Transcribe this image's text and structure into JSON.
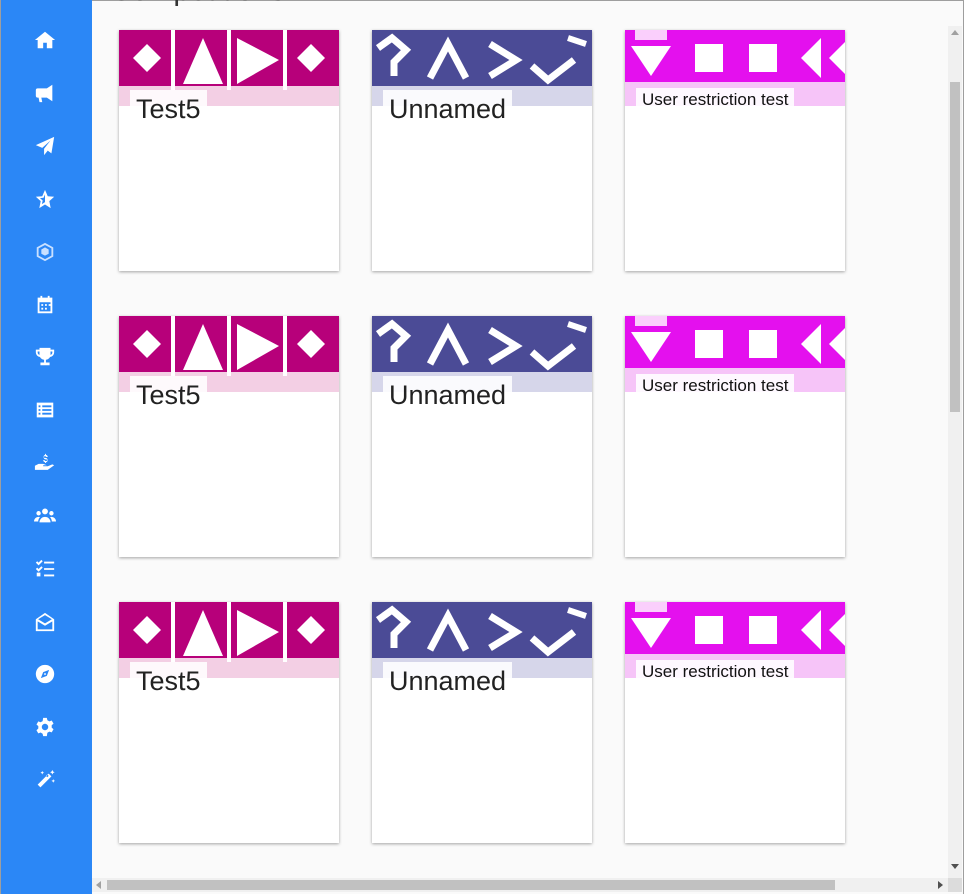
{
  "page": {
    "heading": "Competitions"
  },
  "sidebar": {
    "items": [
      {
        "icon": "home-icon"
      },
      {
        "icon": "megaphone-icon"
      },
      {
        "icon": "paper-plane-icon"
      },
      {
        "icon": "star-icon"
      },
      {
        "icon": "network-icon"
      },
      {
        "icon": "calendar-icon"
      },
      {
        "icon": "trophy-icon"
      },
      {
        "icon": "list-icon"
      },
      {
        "icon": "hand-dollar-icon"
      },
      {
        "icon": "users-icon"
      },
      {
        "icon": "tasks-icon"
      },
      {
        "icon": "envelope-open-icon"
      },
      {
        "icon": "compass-icon"
      },
      {
        "icon": "gear-icon"
      },
      {
        "icon": "magic-wand-icon"
      }
    ]
  },
  "colors": {
    "sidebar": "#2b87f6",
    "banner_test5": "#b7007a",
    "banner_unnamed": "#4b4b96",
    "banner_user": "#e410ee"
  },
  "cards": [
    {
      "title": "Test5",
      "style": "big",
      "pattern": "test5"
    },
    {
      "title": "Unnamed",
      "style": "big",
      "pattern": "unnamed"
    },
    {
      "title": "User restriction test",
      "style": "small",
      "pattern": "user"
    },
    {
      "title": "Test5",
      "style": "big",
      "pattern": "test5"
    },
    {
      "title": "Unnamed",
      "style": "big",
      "pattern": "unnamed"
    },
    {
      "title": "User restriction test",
      "style": "small",
      "pattern": "user"
    },
    {
      "title": "Test5",
      "style": "big",
      "pattern": "test5"
    },
    {
      "title": "Unnamed",
      "style": "big",
      "pattern": "unnamed"
    },
    {
      "title": "User restriction test",
      "style": "small",
      "pattern": "user"
    }
  ]
}
